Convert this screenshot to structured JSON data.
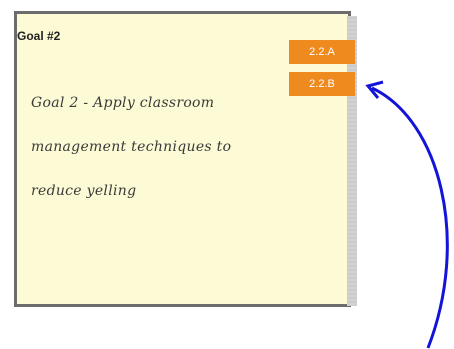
{
  "goal": {
    "title": "Goal #2",
    "text_lines": [
      "Goal 2 - Apply classroom",
      "management techniques to",
      "reduce yelling"
    ]
  },
  "tags": [
    {
      "label": "2.2.A"
    },
    {
      "label": "2.2.B"
    }
  ],
  "colors": {
    "note_background": "#fdfbd6",
    "note_border": "#6c6c6c",
    "tag_background": "#ef8a1f",
    "tag_text": "#ffffff",
    "arrow": "#1414d8"
  },
  "annotation": {
    "icon": "curved-arrow-icon"
  }
}
